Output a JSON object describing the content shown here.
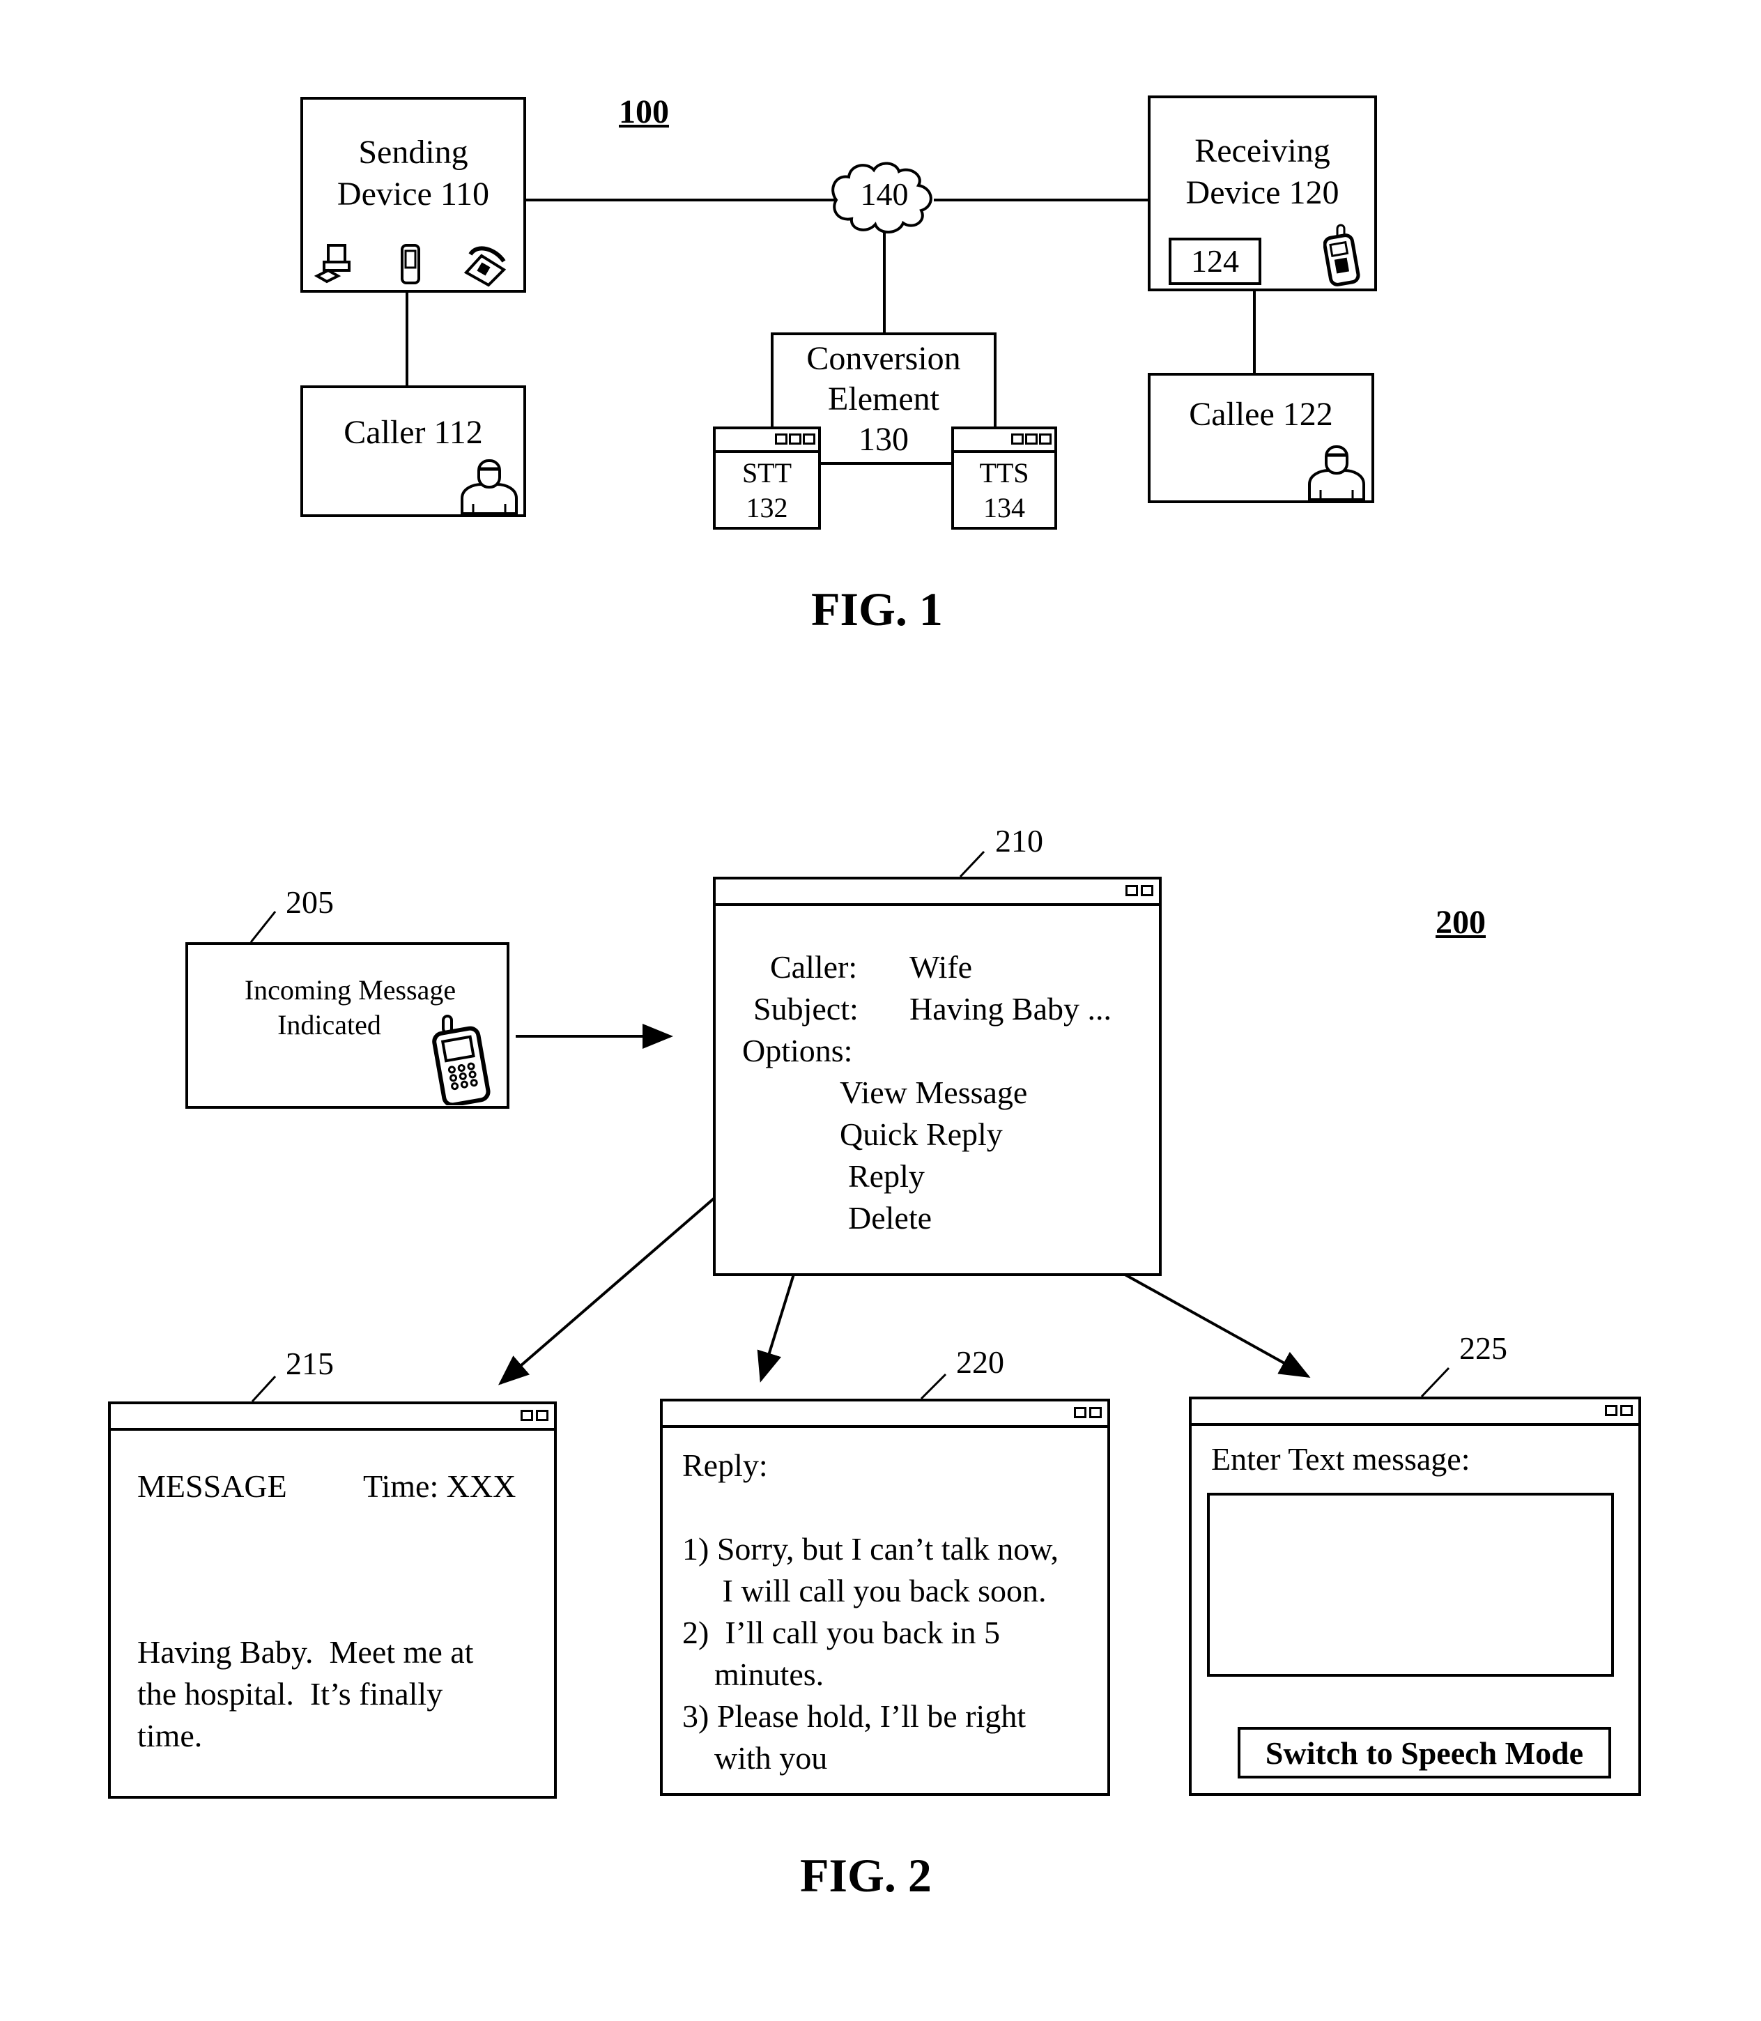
{
  "fig1": {
    "ref_label": "100",
    "caption": "FIG. 1",
    "sending_device": {
      "line1": "Sending",
      "line2": "Device 110",
      "icons": [
        "desktop-computer-icon",
        "handheld-pda-icon",
        "desk-telephone-icon"
      ]
    },
    "caller": {
      "label": "Caller 112",
      "icon": "person-icon"
    },
    "network": {
      "label": "140",
      "icon": "cloud-icon"
    },
    "conversion_element": {
      "line1": "Conversion",
      "line2": "Element",
      "line3": "130"
    },
    "stt": {
      "line1": "STT",
      "line2": "132"
    },
    "tts": {
      "line1": "TTS",
      "line2": "134"
    },
    "receiving_device": {
      "line1": "Receiving",
      "line2": "Device 120",
      "sub_box": "124",
      "icon": "mobile-phone-icon"
    },
    "callee": {
      "label": "Callee 122",
      "icon": "person-icon"
    }
  },
  "fig2": {
    "ref_label": "200",
    "caption": "FIG. 2",
    "incoming": {
      "ref": "205",
      "line1": "Incoming Message",
      "line2": "Indicated",
      "icon": "mobile-phone-icon"
    },
    "options_window": {
      "ref": "210",
      "caller_label": "Caller:",
      "caller_value": "Wife",
      "subject_label": "Subject:",
      "subject_value": "Having Baby ...",
      "options_label": "Options:",
      "options": [
        "View Message",
        "Quick Reply",
        "Reply",
        "Delete"
      ]
    },
    "message_window": {
      "ref": "215",
      "header": "MESSAGE",
      "time": "Time: XXX",
      "body": [
        "Having Baby.  Meet me at",
        "the hospital.  It’s finally",
        "time."
      ]
    },
    "quick_reply_window": {
      "ref": "220",
      "title": "Reply:",
      "lines": [
        "1) Sorry, but I can’t talk now,",
        "     I will call you back soon.",
        "2)  I’ll call you back in 5",
        "    minutes.",
        "3) Please hold, I’ll be right",
        "    with you"
      ]
    },
    "reply_window": {
      "ref": "225",
      "prompt": "Enter Text message:",
      "text_value": "",
      "button": "Switch to Speech Mode"
    }
  }
}
